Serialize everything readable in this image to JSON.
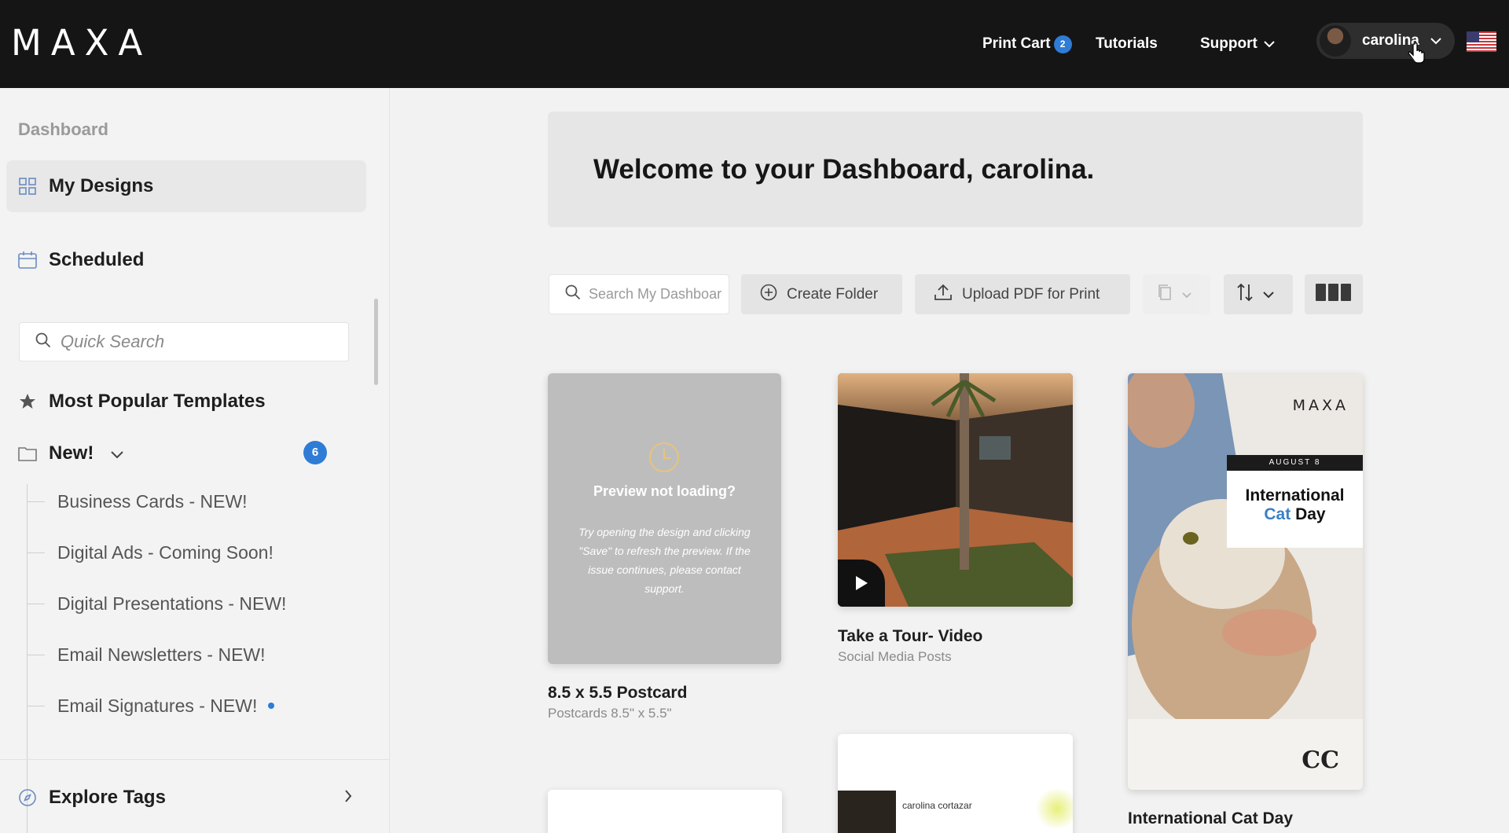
{
  "header": {
    "logo": "MAXA",
    "print_cart_label": "Print Cart",
    "print_cart_count": "2",
    "tutorials_label": "Tutorials",
    "support_label": "Support",
    "user_name": "carolina"
  },
  "sidebar": {
    "dashboard_label": "Dashboard",
    "my_designs_label": "My Designs",
    "scheduled_label": "Scheduled",
    "quick_search_placeholder": "Quick Search",
    "popular_label": "Most Popular Templates",
    "new_label": "New!",
    "new_count": "6",
    "new_items": [
      {
        "label": "Business Cards - NEW!"
      },
      {
        "label": "Digital Ads - Coming Soon!"
      },
      {
        "label": "Digital Presentations - NEW!"
      },
      {
        "label": "Email Newsletters - NEW!"
      },
      {
        "label": "Email Signatures - NEW!"
      }
    ],
    "explore_label": "Explore Tags"
  },
  "main": {
    "welcome": "Welcome to your Dashboard, carolina.",
    "search_placeholder": "Search My Dashboard",
    "create_folder_label": "Create Folder",
    "upload_pdf_label": "Upload PDF for Print"
  },
  "cards": [
    {
      "title": "8.5 x 5.5 Postcard",
      "subtitle": "Postcards 8.5\" x 5.5\"",
      "preview_title": "Preview not loading?",
      "preview_text": "Try opening the design and clicking \"Save\" to refresh the preview. If the issue continues, please contact support."
    },
    {
      "title": "Take a Tour- Video",
      "subtitle": "Social Media Posts"
    },
    {
      "title": "International Cat Day",
      "brand": "MAXA",
      "box_date": "AUGUST 8",
      "box_line1": "International",
      "box_line2_blue": "Cat",
      "box_line2_rest": " Day",
      "monogram": "CC"
    },
    {
      "signature_name": "carolina cortazar"
    }
  ],
  "colors": {
    "topbar": "#151515",
    "accent_blue": "#2e7cd6",
    "sidebar_bg": "#f3f3f3"
  }
}
